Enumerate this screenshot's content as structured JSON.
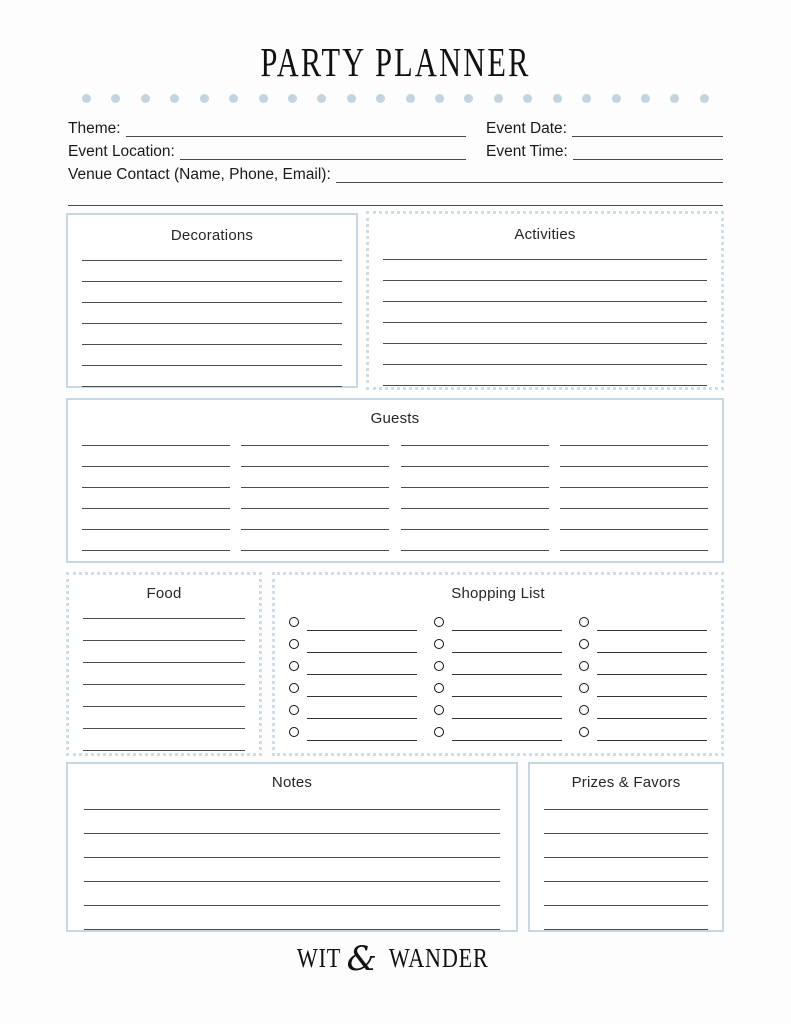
{
  "document": {
    "title": "PARTY PLANNER",
    "divider_dot_count": 22,
    "divider_dot_color": "#c3d4e0",
    "border_color_solid": "#c7d7e2",
    "border_color_dotted": "#cfdde7",
    "rule_color": "#4d4d4d",
    "background": "#fdfdfd"
  },
  "header": {
    "theme_label": "Theme:",
    "event_date_label": "Event Date:",
    "event_location_label": "Event Location:",
    "event_time_label": "Event Time:",
    "venue_contact_label": "Venue Contact (Name, Phone, Email):",
    "theme_value": "",
    "event_date_value": "",
    "event_location_value": "",
    "event_time_value": "",
    "venue_contact_value": "",
    "venue_contact_overflow_value": ""
  },
  "sections": {
    "decorations": {
      "title": "Decorations",
      "border_style": "solid",
      "line_count": 7
    },
    "activities": {
      "title": "Activities",
      "border_style": "dotted",
      "line_count": 7
    },
    "guests": {
      "title": "Guests",
      "border_style": "solid",
      "column_count": 4,
      "rows_per_column": 6
    },
    "food": {
      "title": "Food",
      "border_style": "dotted",
      "line_count": 7
    },
    "shopping_list": {
      "title": "Shopping List",
      "border_style": "dotted",
      "column_count": 3,
      "rows_per_column": 6,
      "checkbox_shape": "circle"
    },
    "notes": {
      "title": "Notes",
      "border_style": "solid",
      "line_count": 6
    },
    "prizes_favors": {
      "title": "Prizes & Favors",
      "border_style": "solid",
      "line_count": 6
    }
  },
  "footer": {
    "brand_first": "WIT",
    "brand_ampersand": "&",
    "brand_second": "WANDER"
  }
}
